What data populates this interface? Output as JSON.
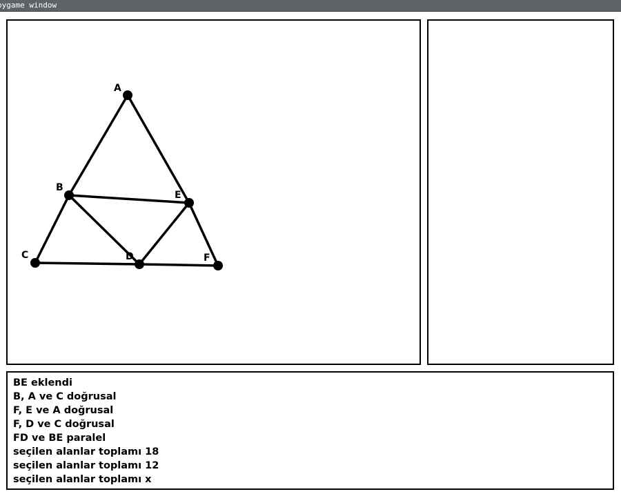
{
  "window": {
    "title": "pygame window"
  },
  "geometry": {
    "points": [
      {
        "name": "A",
        "label": "A"
      },
      {
        "name": "B",
        "label": "B"
      },
      {
        "name": "C",
        "label": "C"
      },
      {
        "name": "D",
        "label": "D"
      },
      {
        "name": "E",
        "label": "E"
      },
      {
        "name": "F",
        "label": "F"
      }
    ],
    "segments": [
      [
        "A",
        "B"
      ],
      [
        "B",
        "C"
      ],
      [
        "A",
        "E"
      ],
      [
        "E",
        "F"
      ],
      [
        "C",
        "D"
      ],
      [
        "D",
        "F"
      ],
      [
        "B",
        "E"
      ],
      [
        "B",
        "D"
      ],
      [
        "D",
        "E"
      ]
    ]
  },
  "log": [
    "BE eklendi",
    "B, A ve C doğrusal",
    "F, E ve A doğrusal",
    "F, D ve C doğrusal",
    "FD ve BE paralel",
    "seçilen alanlar toplamı 18",
    "seçilen alanlar toplamı 12",
    "seçilen alanlar toplamı x"
  ]
}
